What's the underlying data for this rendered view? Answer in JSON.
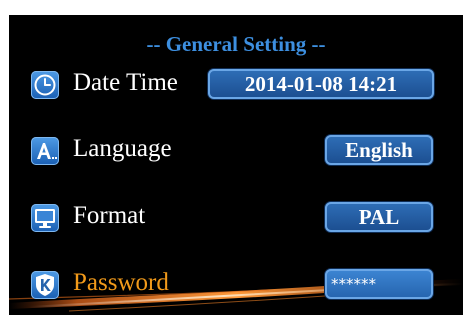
{
  "title": "--  General Setting  --",
  "colors": {
    "background": "#000000",
    "title": "#3d8fe0",
    "label": "#ffffff",
    "selected_label": "#f29a1a",
    "value_box": "#2a64a8"
  },
  "rows": [
    {
      "icon": "clock-icon",
      "label": "Date Time",
      "value": "2014-01-08   14:21"
    },
    {
      "icon": "language-icon",
      "label": "Language",
      "value": "English"
    },
    {
      "icon": "monitor-icon",
      "label": "Format",
      "value": "PAL"
    },
    {
      "icon": "key-icon",
      "label": "Password",
      "value": "******",
      "selected": true
    }
  ]
}
